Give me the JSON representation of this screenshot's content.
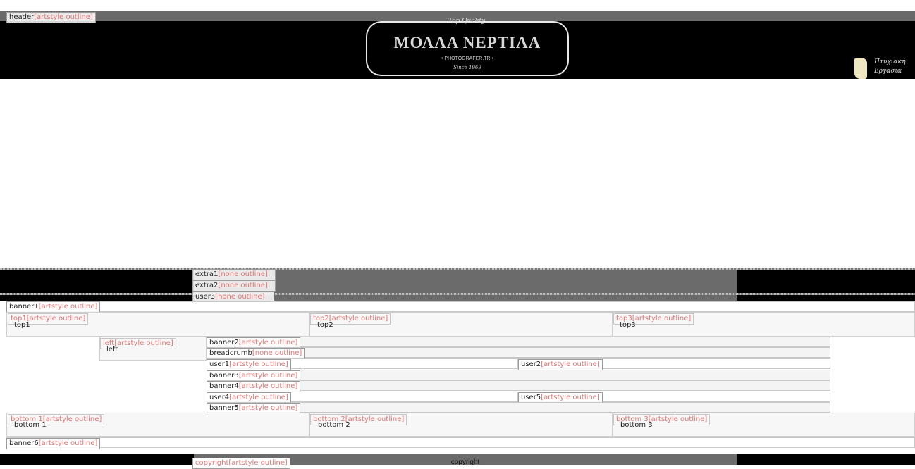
{
  "style_suffix": "[artstyle outline]",
  "style_suffix_none": "[none outline]",
  "header": {
    "tag_name": "header",
    "logo": {
      "tagline": "Top Quality",
      "brand": "ΜΟΛΛΑ ΝΕΡΤΙΛΑ",
      "subtitle": "• PHOTOGRAFER.TR •",
      "since": "Since 1969"
    },
    "thesis_link": {
      "line1": "Πτυχιακή",
      "line2": "Εργασία"
    }
  },
  "nav": [
    {
      "name": "extra1"
    },
    {
      "name": "extra2"
    },
    {
      "name": "user3"
    }
  ],
  "banner1": "banner1",
  "top_positions": [
    {
      "name": "top1",
      "label": "top1"
    },
    {
      "name": "top2",
      "label": "top2"
    },
    {
      "name": "top3",
      "label": "top3"
    }
  ],
  "left": {
    "name": "left",
    "label": "left"
  },
  "main_rows": {
    "banner2": "banner2",
    "breadcrumb": "breadcrumb",
    "user1": "user1",
    "user2": "user2",
    "banner3": "banner3",
    "banner4": "banner4",
    "user4": "user4",
    "user5": "user5",
    "banner5": "banner5"
  },
  "bottom_positions": [
    {
      "name": "bottom 1",
      "label": "bottom 1"
    },
    {
      "name": "bottom 2",
      "label": "bottom 2"
    },
    {
      "name": "bottom 3",
      "label": "bottom 3"
    }
  ],
  "banner6": "banner6",
  "footer": {
    "tag_name": "copyright",
    "label": "copyright"
  },
  "colors": {
    "black": "#000000",
    "gray_bar": "#7a7a7a",
    "style_text": "#e07575"
  }
}
